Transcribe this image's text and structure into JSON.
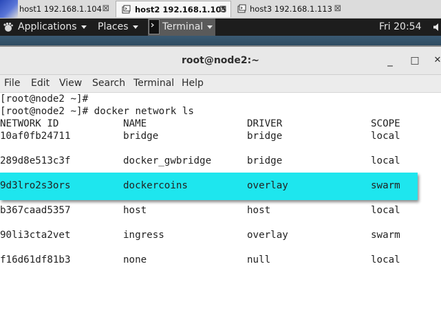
{
  "host_tabs": [
    {
      "label": "host1 192.168.1.104",
      "close": "⊠",
      "active": false
    },
    {
      "label": "host2 192.168.1.105",
      "close": "⊠",
      "active": true
    },
    {
      "label": "host3 192.168.1.113",
      "close": "⊠",
      "active": false
    }
  ],
  "panel": {
    "applications": "Applications",
    "places": "Places",
    "terminal": "Terminal",
    "clock": "Fri 20:54"
  },
  "window": {
    "title": "root@node2:~",
    "minimize": "_",
    "maximize": "□",
    "close": "✕"
  },
  "menubar": [
    "File",
    "Edit",
    "View",
    "Search",
    "Terminal",
    "Help"
  ],
  "terminal": {
    "lines": [
      "[root@node2 ~]#",
      "[root@node2 ~]# docker network ls"
    ],
    "headers": [
      "NETWORK ID",
      "NAME",
      "DRIVER",
      "SCOPE"
    ],
    "rows": [
      [
        "10af0fb24711",
        "bridge",
        "bridge",
        "local"
      ],
      [
        "289d8e513c3f",
        "docker_gwbridge",
        "bridge",
        "local"
      ],
      [
        "9d3lro2s3ors",
        "dockercoins",
        "overlay",
        "swarm"
      ],
      [
        "b367caad5357",
        "host",
        "host",
        "local"
      ],
      [
        "90li3cta2vet",
        "ingress",
        "overlay",
        "swarm"
      ],
      [
        "f16d61df81b3",
        "none",
        "null",
        "local"
      ]
    ],
    "highlighted_row": 2,
    "highlight_color": "#1ee6ee"
  }
}
